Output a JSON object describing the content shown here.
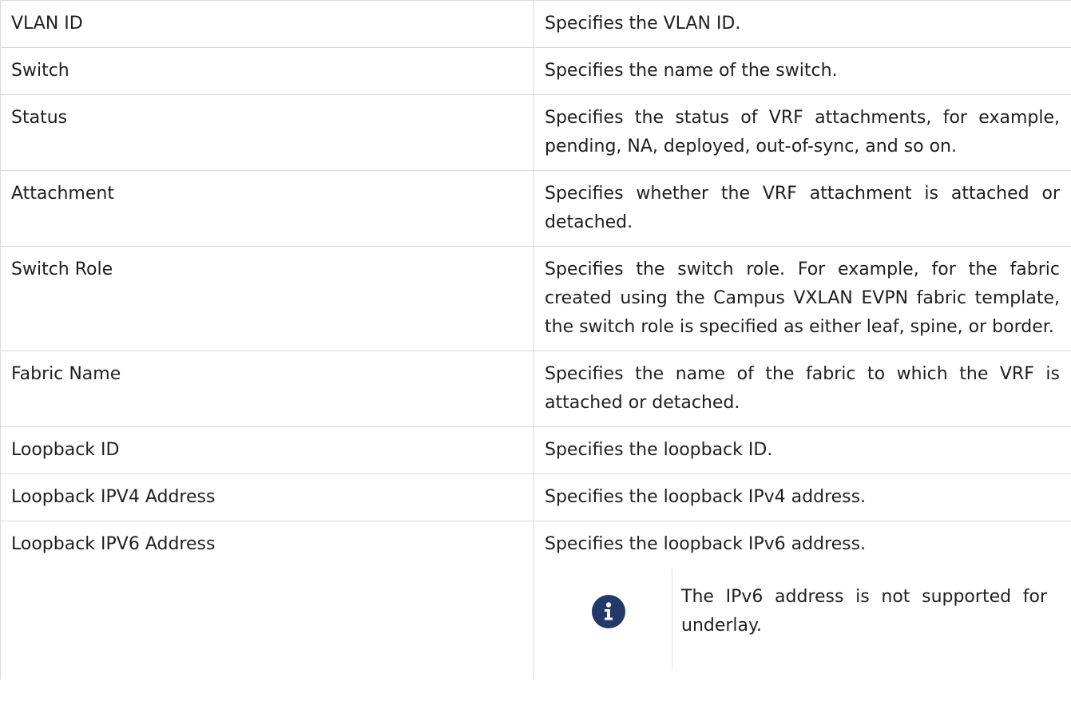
{
  "table": {
    "rows": [
      {
        "param": "VLAN ID",
        "desc": "Specifies the VLAN ID."
      },
      {
        "param": "Switch",
        "desc": "Specifies the name of the switch."
      },
      {
        "param": "Status",
        "desc": "Specifies the status of VRF attachments, for example, pending, NA, deployed, out-of-sync, and so on."
      },
      {
        "param": "Attachment",
        "desc": "Specifies whether the VRF attachment is attached or detached."
      },
      {
        "param": "Switch Role",
        "desc": "Specifies the switch role. For example, for the fabric created using the Campus VXLAN EVPN fabric template, the switch role is specified as either leaf, spine, or border."
      },
      {
        "param": "Fabric Name",
        "desc": "Specifies the name of the fabric to which the VRF is attached or detached."
      },
      {
        "param": "Loopback ID",
        "desc": "Specifies the loopback ID."
      },
      {
        "param": "Loopback IPV4 Address",
        "desc": "Specifies the loopback IPv4 address."
      },
      {
        "param": "Loopback IPV6 Address",
        "desc": "Specifies the loopback IPv6 address."
      }
    ]
  },
  "note": {
    "icon": "info-icon",
    "text": "The IPv6 address is not supported for underlay.",
    "icon_color": "#223a6a"
  }
}
